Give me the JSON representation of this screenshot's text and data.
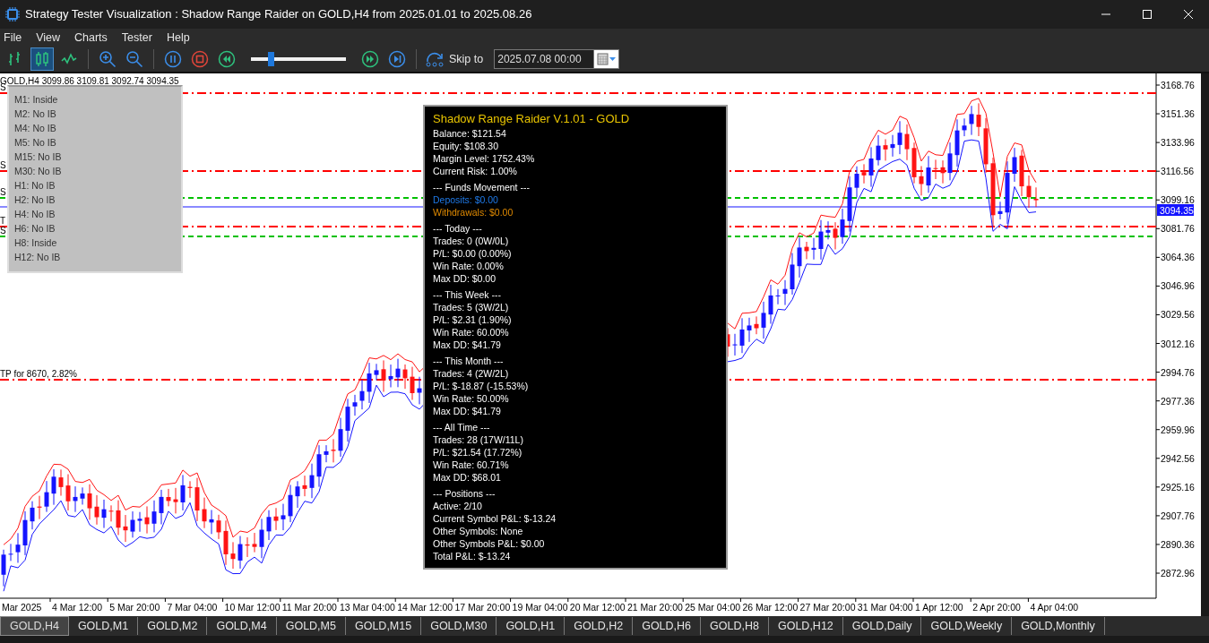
{
  "window": {
    "title": "Strategy Tester Visualization : Shadow Range Raider on GOLD,H4 from 2025.01.01 to 2025.08.26"
  },
  "menu": [
    "File",
    "View",
    "Charts",
    "Tester",
    "Help"
  ],
  "toolbar": {
    "chart_modes": [
      {
        "kind": "bars",
        "selected": false
      },
      {
        "kind": "candles",
        "selected": true
      },
      {
        "kind": "line",
        "selected": false
      }
    ],
    "speed": {
      "level": 0.21
    },
    "skip_label": "Skip to",
    "skip_date": "2025.07.08 00:00"
  },
  "chart": {
    "ohlc": "GOLD,H4  3099.86 3109.81 3092.74 3094.35",
    "price_ticks": [
      "3168.76",
      "3151.36",
      "3133.96",
      "3116.56",
      "3099.16",
      "3081.76",
      "3064.36",
      "3046.96",
      "3029.56",
      "3012.16",
      "2994.76",
      "2977.36",
      "2959.96",
      "2942.56",
      "2925.16",
      "2907.76",
      "2890.36",
      "2872.96"
    ],
    "current_price": "3094.35",
    "time_labels": [
      "Mar 2025",
      "4 Mar 12:00",
      "5 Mar 20:00",
      "7 Mar 04:00",
      "10 Mar 12:00",
      "11 Mar 20:00",
      "13 Mar 04:00",
      "14 Mar 12:00",
      "17 Mar 20:00",
      "19 Mar 04:00",
      "20 Mar 12:00",
      "21 Mar 20:00",
      "25 Mar 04:00",
      "26 Mar 12:00",
      "27 Mar 20:00",
      "31 Mar 04:00",
      "1 Apr 12:00",
      "2 Apr 20:00",
      "4 Apr 04:00"
    ],
    "levels": [
      {
        "label": "S",
        "kind": "dashdot",
        "color": "#ff0000"
      },
      {
        "label": "S",
        "kind": "dashdot",
        "color": "#ff0000"
      },
      {
        "label": "S",
        "kind": "dashed",
        "color": "#00c000"
      },
      {
        "label": "T",
        "kind": "dashdot",
        "color": "#ff0000"
      },
      {
        "label": "S",
        "kind": "dashed",
        "color": "#00c000"
      },
      {
        "label": "TP for 8670, 2.82%",
        "kind": "dashdot",
        "color": "#ff0000"
      }
    ]
  },
  "ib_panel": [
    "M1: Inside",
    "M2: No IB",
    "M4: No IB",
    "M5: No IB",
    "M15: No IB",
    "M30: No IB",
    "H1: No IB",
    "H2: No IB",
    "H4: No IB",
    "H6: No IB",
    "H8: Inside",
    "H12: No IB"
  ],
  "stats": {
    "title": "Shadow Range Raider V.1.01 - GOLD",
    "lines": [
      {
        "text": "Balance: $121.54",
        "kind": "value"
      },
      {
        "text": "Equity: $108.30",
        "kind": "value"
      },
      {
        "text": "Margin Level: 1752.43%",
        "kind": "value"
      },
      {
        "text": "Current Risk: 1.00%",
        "kind": "value"
      },
      {
        "text": "--- Funds Movement ---",
        "kind": "section"
      },
      {
        "text": "Deposits: $0.00",
        "kind": "deposit"
      },
      {
        "text": "Withdrawals: $0.00",
        "kind": "withdrawal"
      },
      {
        "text": "--- Today ---",
        "kind": "section"
      },
      {
        "text": "Trades: 0 (0W/0L)",
        "kind": "value"
      },
      {
        "text": "P/L: $0.00 (0.00%)",
        "kind": "value"
      },
      {
        "text": "Win Rate: 0.00%",
        "kind": "value"
      },
      {
        "text": "Max DD: $0.00",
        "kind": "value"
      },
      {
        "text": "--- This Week ---",
        "kind": "section"
      },
      {
        "text": "Trades: 5 (3W/2L)",
        "kind": "value"
      },
      {
        "text": "P/L: $2.31 (1.90%)",
        "kind": "value"
      },
      {
        "text": "Win Rate: 60.00%",
        "kind": "value"
      },
      {
        "text": "Max DD: $41.79",
        "kind": "value"
      },
      {
        "text": "--- This Month ---",
        "kind": "section"
      },
      {
        "text": "Trades: 4 (2W/2L)",
        "kind": "value"
      },
      {
        "text": "P/L: $-18.87 (-15.53%)",
        "kind": "value"
      },
      {
        "text": "Win Rate: 50.00%",
        "kind": "value"
      },
      {
        "text": "Max DD: $41.79",
        "kind": "value"
      },
      {
        "text": "--- All Time ---",
        "kind": "section"
      },
      {
        "text": "Trades: 28 (17W/11L)",
        "kind": "value"
      },
      {
        "text": "P/L: $21.54 (17.72%)",
        "kind": "value"
      },
      {
        "text": "Win Rate: 60.71%",
        "kind": "value"
      },
      {
        "text": "Max DD: $68.01",
        "kind": "value"
      },
      {
        "text": "--- Positions ---",
        "kind": "section"
      },
      {
        "text": "Active: 2/10",
        "kind": "value"
      },
      {
        "text": "Current Symbol P&L: $-13.24",
        "kind": "value"
      },
      {
        "text": "Other Symbols: None",
        "kind": "value"
      },
      {
        "text": "Other Symbols P&L: $0.00",
        "kind": "value"
      },
      {
        "text": "Total P&L: $-13.24",
        "kind": "value"
      }
    ]
  },
  "symbol_tabs": [
    {
      "label": "GOLD,H4",
      "selected": true
    },
    {
      "label": "GOLD,M1",
      "selected": false
    },
    {
      "label": "GOLD,M2",
      "selected": false
    },
    {
      "label": "GOLD,M4",
      "selected": false
    },
    {
      "label": "GOLD,M5",
      "selected": false
    },
    {
      "label": "GOLD,M15",
      "selected": false
    },
    {
      "label": "GOLD,M30",
      "selected": false
    },
    {
      "label": "GOLD,H1",
      "selected": false
    },
    {
      "label": "GOLD,H2",
      "selected": false
    },
    {
      "label": "GOLD,H6",
      "selected": false
    },
    {
      "label": "GOLD,H8",
      "selected": false
    },
    {
      "label": "GOLD,H12",
      "selected": false
    },
    {
      "label": "GOLD,Daily",
      "selected": false
    },
    {
      "label": "GOLD,Weekly",
      "selected": false
    },
    {
      "label": "GOLD,Monthly",
      "selected": false
    }
  ]
}
